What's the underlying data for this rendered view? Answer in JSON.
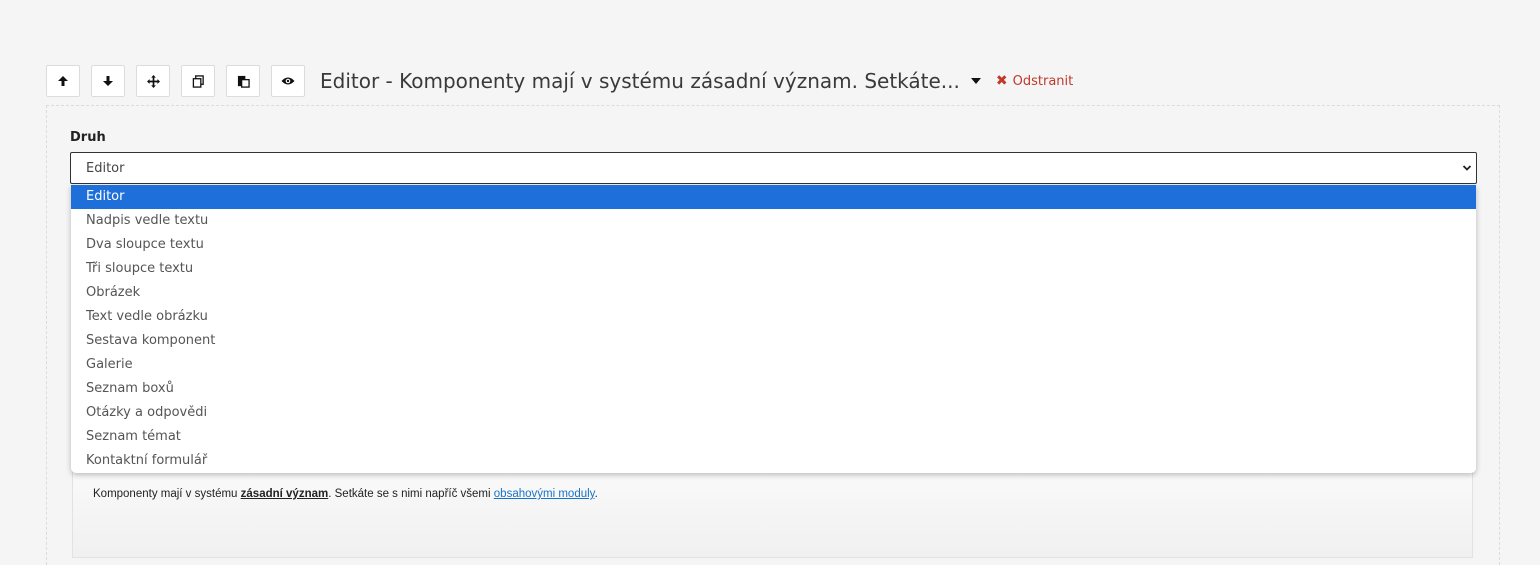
{
  "toolbar": {
    "buttons": [
      {
        "name": "move-up-button",
        "icon": "arrow-up-icon"
      },
      {
        "name": "move-down-button",
        "icon": "arrow-down-icon"
      },
      {
        "name": "drag-button",
        "icon": "move-icon"
      },
      {
        "name": "duplicate-button",
        "icon": "copy-icon"
      },
      {
        "name": "paste-button",
        "icon": "paste-icon"
      },
      {
        "name": "preview-button",
        "icon": "eye-icon"
      }
    ],
    "title": "Editor - Komponenty mají v systému zásadní význam. Setkáte...",
    "remove_icon": "✖",
    "remove_label": "Odstranit",
    "remove_color": "#c0392b"
  },
  "form": {
    "druh_label": "Druh",
    "select_value": "Editor"
  },
  "dropdown": {
    "selected_color": "#1e6fd9",
    "options": [
      "Editor",
      "Nadpis vedle textu",
      "Dva sloupce textu",
      "Tři sloupce textu",
      "Obrázek",
      "Text vedle obrázku",
      "Sestava komponent",
      "Galerie",
      "Seznam boxů",
      "Otázky a odpovědi",
      "Seznam témat",
      "Kontaktní formulář"
    ]
  },
  "editor": {
    "text_before": "Komponenty mají v systému ",
    "bold_text": "zásadní význam",
    "text_middle": ". Setkáte se s nimi napříč všemi ",
    "link_text": "obsahovými moduly",
    "text_after": "."
  }
}
